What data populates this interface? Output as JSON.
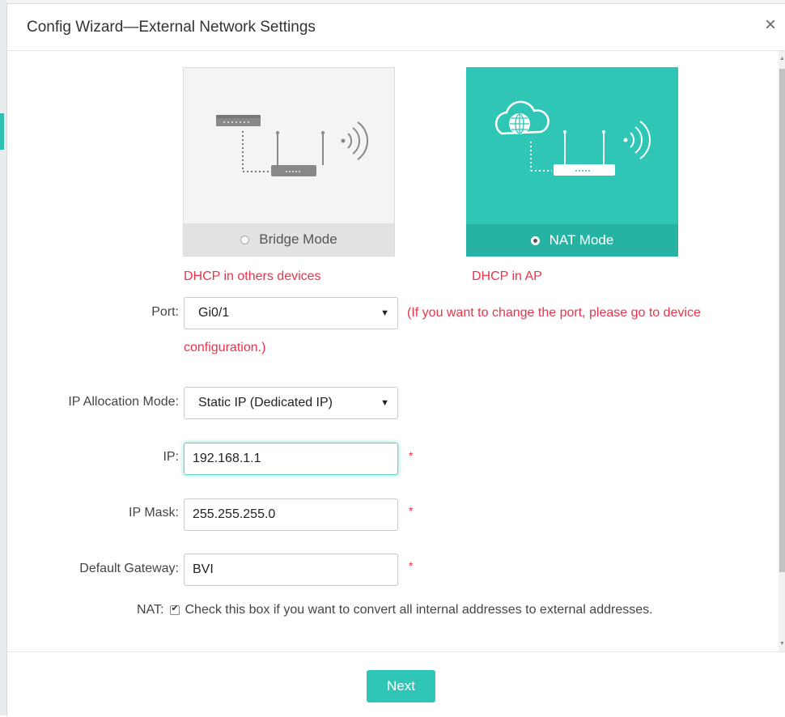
{
  "dialog": {
    "title": "Config Wizard—External Network Settings",
    "close_label": "×"
  },
  "modes": {
    "bridge": {
      "label": "Bridge Mode",
      "description": "DHCP in others devices",
      "selected": false
    },
    "nat": {
      "label": "NAT Mode",
      "description": "DHCP in AP",
      "selected": true
    }
  },
  "form": {
    "port": {
      "label": "Port:",
      "value": "Gi0/1",
      "hint_line1": "(If you want to change the port, please go to device",
      "hint_line2": "configuration.)"
    },
    "ip_allocation": {
      "label": "IP Allocation Mode:",
      "value": "Static IP (Dedicated IP)"
    },
    "ip": {
      "label": "IP:",
      "value": "192.168.1.1",
      "required": "*"
    },
    "ip_mask": {
      "label": "IP Mask:",
      "value": "255.255.255.0",
      "required": "*"
    },
    "gateway": {
      "label": "Default Gateway:",
      "value": "BVI",
      "required": "*"
    },
    "nat": {
      "label": "NAT:",
      "checked": true,
      "text": "Check this box if you want to convert all internal addresses to external addresses."
    }
  },
  "footer": {
    "next_label": "Next"
  },
  "colors": {
    "accent": "#2fc6b6",
    "error": "#e8344b"
  }
}
